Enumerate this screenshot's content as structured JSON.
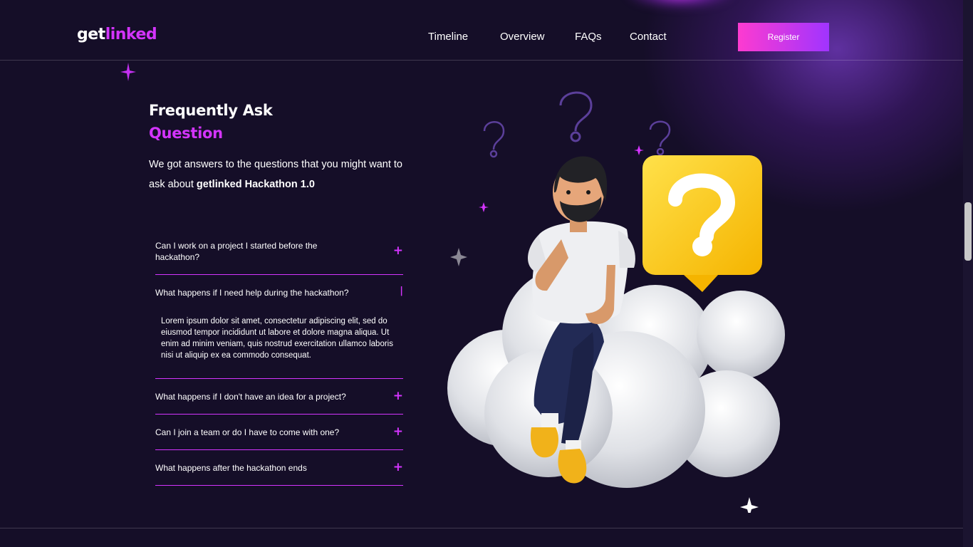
{
  "header": {
    "logo_part1": "get",
    "logo_part2": "linked",
    "nav": [
      "Timeline",
      "Overview",
      "FAQs",
      "Contact"
    ],
    "register_label": "Register"
  },
  "faq_section": {
    "title_line1": "Frequently Ask",
    "title_line2": "Question",
    "intro_text": "We got answers to the questions that you might want to ask about ",
    "intro_bold": "getlinked Hackathon 1.0",
    "items": [
      {
        "question": "Can I work on a project I started before the hackathon?",
        "toggle": "+"
      },
      {
        "question": "What happens if I need help during the hackathon?",
        "toggle": "|",
        "answer": "Lorem ipsum dolor sit amet, consectetur adipiscing elit, sed do eiusmod tempor incididunt ut labore et dolore magna aliqua. Ut enim ad minim veniam, quis nostrud exercitation ullamco laboris nisi ut aliquip ex ea commodo consequat."
      },
      {
        "question": "What happens if I don't have an idea for a project?",
        "toggle": "+"
      },
      {
        "question": "Can I join a team or do I have to come with one?",
        "toggle": "+"
      },
      {
        "question": "What happens after the hackathon ends",
        "toggle": "+"
      }
    ]
  },
  "colors": {
    "background": "#150e28",
    "accent": "#d434fe",
    "register_gradient_start": "#fd3bd0",
    "register_gradient_end": "#a034ff"
  },
  "icons": [
    "sparkle-icon",
    "plus-icon",
    "minus-icon",
    "question-mark-icon"
  ]
}
